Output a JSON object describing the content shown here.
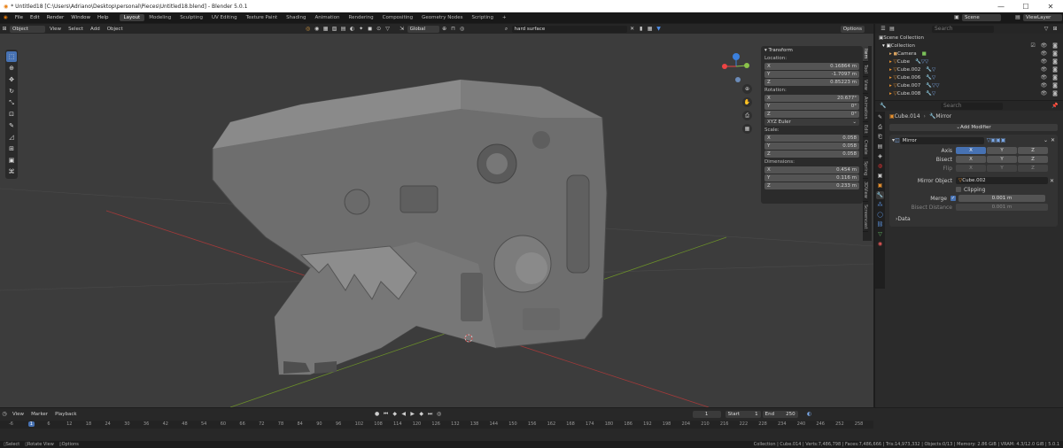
{
  "window": {
    "title": "* Untitled18 [C:\\Users\\Adriano\\Desktop\\personal\\Pieces\\Untitled18.blend] - Blender 5.0.1"
  },
  "menu": {
    "items": [
      "File",
      "Edit",
      "Render",
      "Window",
      "Help"
    ]
  },
  "workspaces": [
    "Layout",
    "Modeling",
    "Sculpting",
    "UV Editing",
    "Texture Paint",
    "Shading",
    "Animation",
    "Rendering",
    "Compositing",
    "Geometry Nodes",
    "Scripting"
  ],
  "scene": {
    "name": "Scene",
    "view_layer": "ViewLayer"
  },
  "viewport_header": {
    "mode": "Object Mode",
    "menus": [
      "View",
      "Select",
      "Add",
      "Object"
    ],
    "orientation": "Global",
    "search_value": "hard surface",
    "options_label": "Options"
  },
  "npanel": {
    "header": "Transform",
    "location_label": "Location:",
    "location": [
      {
        "axis": "X",
        "value": "0.16864 m"
      },
      {
        "axis": "Y",
        "value": "-1.7097 m"
      },
      {
        "axis": "Z",
        "value": "0.85223 m"
      }
    ],
    "rotation_label": "Rotation:",
    "rotation": [
      {
        "axis": "X",
        "value": "20.677°"
      },
      {
        "axis": "Y",
        "value": "0°"
      },
      {
        "axis": "Z",
        "value": "0°"
      }
    ],
    "rotation_mode": "XYZ Euler",
    "scale_label": "Scale:",
    "scale": [
      {
        "axis": "X",
        "value": "0.058"
      },
      {
        "axis": "Y",
        "value": "0.058"
      },
      {
        "axis": "Z",
        "value": "0.058"
      }
    ],
    "dimensions_label": "Dimensions:",
    "dimensions": [
      {
        "axis": "X",
        "value": "0.454 m"
      },
      {
        "axis": "Y",
        "value": "0.116 m"
      },
      {
        "axis": "Z",
        "value": "0.233 m"
      }
    ],
    "tabs": [
      "Item",
      "Tool",
      "View",
      "Animation",
      "Edit",
      "Create",
      "Spring",
      "3DView",
      "Screencast"
    ]
  },
  "outliner": {
    "search_placeholder": "Search",
    "root": "Scene Collection",
    "collection": "Collection",
    "items": [
      "Camera",
      "Cube",
      "Cube.002",
      "Cube.006",
      "Cube.007",
      "Cube.008"
    ]
  },
  "properties": {
    "search_placeholder": "Search",
    "object": "Cube.014",
    "modifier_breadcrumb": "Mirror",
    "add_modifier": "Add Modifier",
    "modifier_name": "Mirror",
    "axis_label": "Axis",
    "bisect_label": "Bisect",
    "flip_label": "Flip",
    "axes": [
      "X",
      "Y",
      "Z"
    ],
    "mirror_object_label": "Mirror Object",
    "mirror_object": "Cube.002",
    "clipping_label": "Clipping",
    "merge_label": "Merge",
    "merge_value": "0.001 m",
    "bisect_distance_label": "Bisect Distance",
    "bisect_distance_value": "0.001 m",
    "data_label": "Data"
  },
  "timeline": {
    "menus": [
      "View",
      "Marker",
      "Playback"
    ],
    "current_frame": "1",
    "start_label": "Start",
    "start": "1",
    "end_label": "End",
    "end": "250",
    "ticks": [
      "-6",
      "1",
      "6",
      "12",
      "18",
      "24",
      "30",
      "36",
      "42",
      "48",
      "54",
      "60",
      "66",
      "72",
      "78",
      "84",
      "90",
      "96",
      "102",
      "108",
      "114",
      "120",
      "126",
      "132",
      "138",
      "144",
      "150",
      "156",
      "162",
      "168",
      "174",
      "180",
      "186",
      "192",
      "198",
      "204",
      "210",
      "216",
      "222",
      "228",
      "234",
      "240",
      "246",
      "252",
      "258"
    ]
  },
  "status": {
    "left": [
      "Select",
      "Rotate View",
      "Options"
    ],
    "right": "Collection | Cube.014 | Verts:7,486,798 | Faces:7,486,666 | Tris:14,973,332 | Objects:0/13 | Memory: 2.86 GiB | VRAM: 4.3/12.0 GiB | 5.0.1"
  },
  "colors": {
    "accent": "#4772b3",
    "viewport": "#3c3c3c",
    "panel": "#2b2b2b"
  }
}
